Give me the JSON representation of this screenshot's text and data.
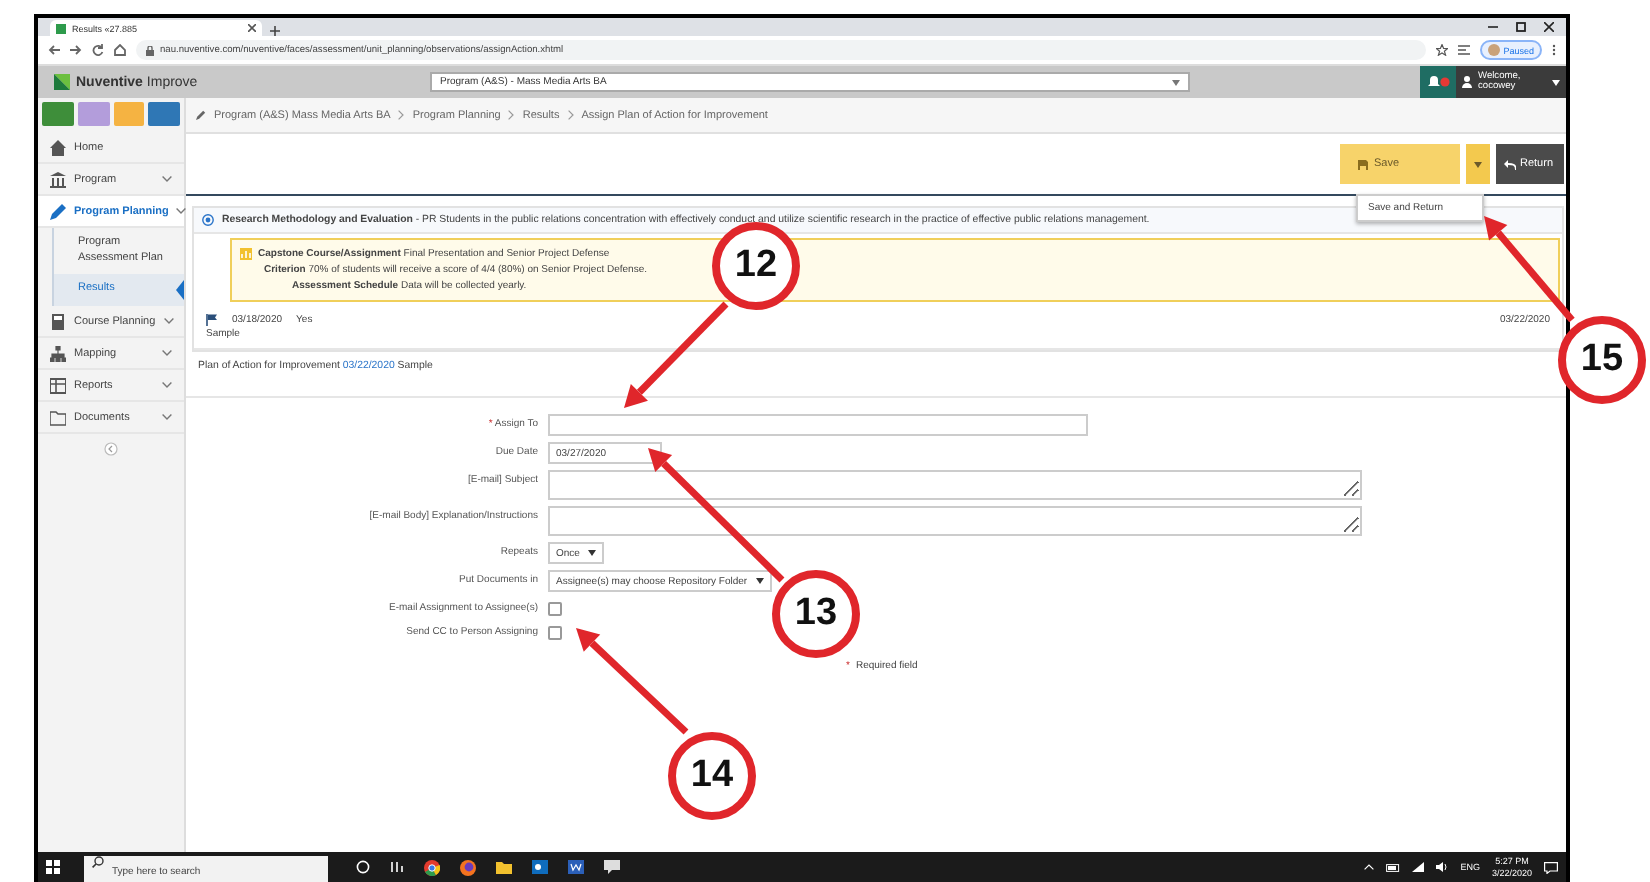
{
  "browser": {
    "tab_title": "Results «27.885",
    "url": "nau.nuventive.com/nuventive/faces/assessment/unit_planning/observations/assignAction.xhtml",
    "profile": "Paused"
  },
  "app_header": {
    "brand": "**Nuventive** Improve",
    "program_select": "Program (A&S) - Mass Media Arts BA",
    "user": "Welcome, cocowey"
  },
  "quick_buttons": [
    {
      "color": "#3e8e3a"
    },
    {
      "color": "#b39ddb"
    },
    {
      "color": "#f5b342"
    },
    {
      "color": "#2f77b5"
    }
  ],
  "breadcrumb": [
    "Program (A&S)  Mass Media Arts BA",
    "Program Planning",
    "Results",
    "Assign Plan of Action for Improvement"
  ],
  "sidebar": {
    "items": [
      {
        "label": "Home",
        "selected": false,
        "has_caret": false
      },
      {
        "label": "Program",
        "selected": false,
        "has_caret": true
      },
      {
        "label": "Program Planning",
        "selected": true,
        "has_caret": true,
        "children": [
          {
            "label": "Program Assessment Plan",
            "selected": false
          },
          {
            "label": "Results",
            "selected": true
          }
        ]
      },
      {
        "label": "Course Planning",
        "selected": false,
        "has_caret": true
      },
      {
        "label": "Mapping",
        "selected": false,
        "has_caret": true
      },
      {
        "label": "Reports",
        "selected": false,
        "has_caret": true
      },
      {
        "label": "Documents",
        "selected": false,
        "has_caret": true
      }
    ]
  },
  "toolbar": {
    "save": "Save",
    "return": "Return",
    "menu": [
      "Save and Return"
    ]
  },
  "objective": "**Research Methodology and Evaluation** - PR Students in the public relations concentration with effectively conduct and utilize scientific research in the practice of effective public relations management.",
  "assessment": {
    "method": "**Capstone Course/Assignment** Final Presentation and Senior Project Defense",
    "criterion": "**Criterion** 70% of students will receive a score of 4/4 (80%) on Senior Project Defense.",
    "schedule": "**Assessment Schedule** Data will be collected yearly."
  },
  "result": {
    "date": "03/18/2020",
    "met": "Yes",
    "note": "Sample",
    "updated": "03/22/2020"
  },
  "plan": {
    "label": "Plan of Action for Improvement",
    "date": "03/22/2020",
    "text": "Sample"
  },
  "form": {
    "required_mark": "*",
    "fields": [
      {
        "kind": "text",
        "label": "Assign To",
        "required": true
      },
      {
        "kind": "date",
        "label": "Due Date",
        "value": "03/27/2020",
        "required": false
      },
      {
        "kind": "textarea",
        "label": "[E-mail] Subject",
        "required": false
      },
      {
        "kind": "textarea",
        "label": "[E-mail Body] Explanation/Instructions",
        "required": false
      },
      {
        "kind": "select",
        "label": "Repeats",
        "value": "Once",
        "required": false
      },
      {
        "kind": "select",
        "label": "Put Documents in",
        "value": "Assignee(s) may choose Repository Folder",
        "required": false
      },
      {
        "kind": "checkbox",
        "label": "E-mail Assignment to Assignee(s)",
        "checked": false,
        "required": false
      },
      {
        "kind": "checkbox",
        "label": "Send CC to Person Assigning",
        "checked": false,
        "required": false
      }
    ],
    "required_note": "Required field"
  },
  "taskbar": {
    "search_placeholder": "Type here to search",
    "language": "ENG",
    "time": "5:27 PM",
    "date": "3/22/2020"
  },
  "callouts": [
    {
      "number": "12"
    },
    {
      "number": "13"
    },
    {
      "number": "14"
    },
    {
      "number": "15"
    }
  ]
}
